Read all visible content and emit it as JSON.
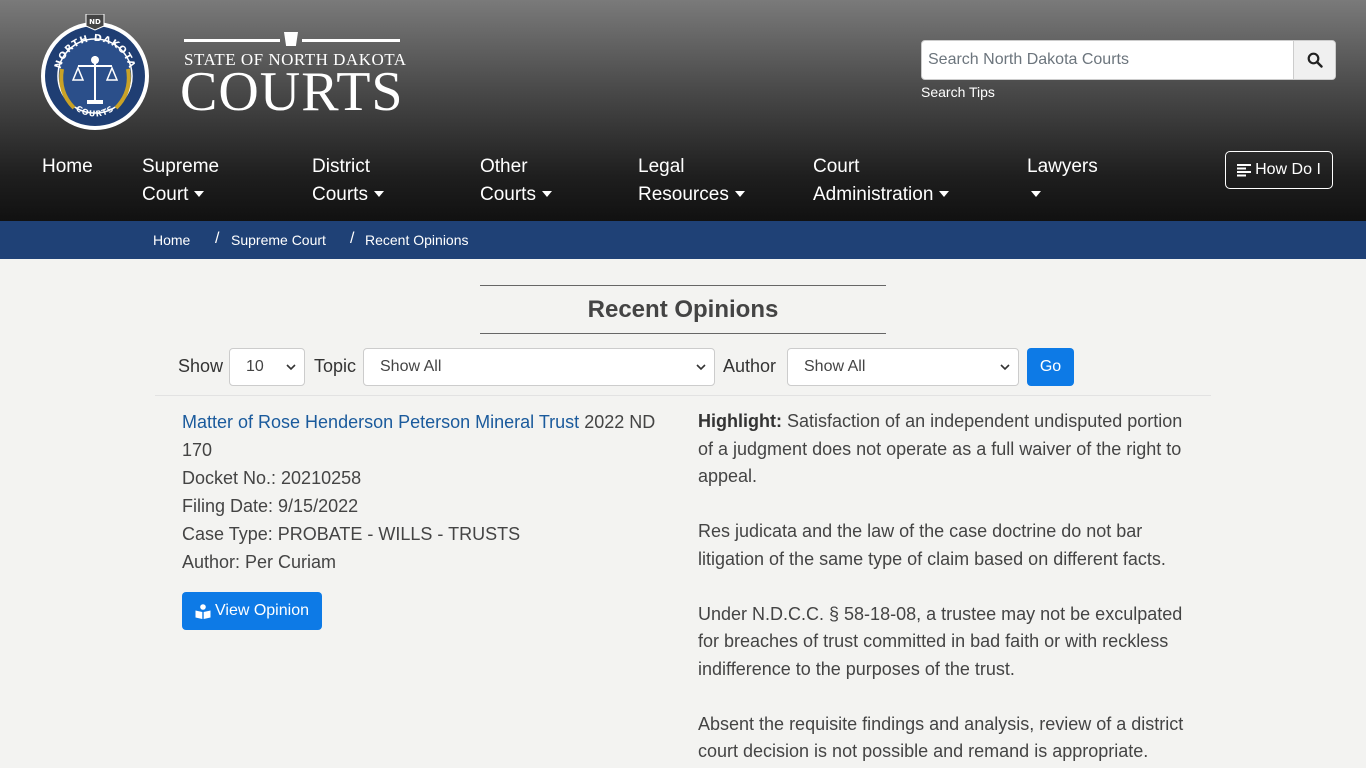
{
  "header": {
    "seal": {
      "top_text": "NORTH DAKOTA",
      "bottom_text": "COURTS",
      "badge": "ND"
    },
    "logo": {
      "small": "STATE OF NORTH DAKOTA",
      "big": "COURTS"
    },
    "search": {
      "placeholder": "Search North Dakota Courts",
      "tips": "Search Tips"
    }
  },
  "nav": {
    "items": [
      {
        "line1": "Home",
        "line2": ""
      },
      {
        "line1": "Supreme",
        "line2": "Court"
      },
      {
        "line1": "District",
        "line2": "Courts"
      },
      {
        "line1": "Other",
        "line2": "Courts"
      },
      {
        "line1": "Legal",
        "line2": "Resources"
      },
      {
        "line1": "Court",
        "line2": "Administration"
      },
      {
        "line1": "Lawyers",
        "line2": ""
      }
    ],
    "how_do_i": "How Do I"
  },
  "breadcrumb": [
    "Home",
    "Supreme Court",
    "Recent Opinions"
  ],
  "page": {
    "title": "Recent Opinions",
    "filters": {
      "show_label": "Show",
      "show_value": "10",
      "topic_label": "Topic",
      "topic_value": "Show All",
      "author_label": "Author",
      "author_value": "Show All",
      "go": "Go"
    },
    "opinion": {
      "title": "Matter of Rose Henderson Peterson Mineral Trust",
      "citation": "2022 ND 170",
      "docket": "Docket No.: 20210258",
      "filing_date": "Filing Date: 9/15/2022",
      "case_type": "Case Type: PROBATE - WILLS - TRUSTS",
      "author": "Author: Per Curiam",
      "view_button": "View Opinion",
      "highlight_label": "Highlight:",
      "highlights": [
        "Satisfaction of an independent undisputed portion of a judgment does not operate as a full waiver of the right to appeal.",
        "Res judicata and the law of the case doctrine do not bar litigation of the same type of claim based on different facts.",
        "Under N.D.C.C. § 58-18-08, a trustee may not be exculpated for breaches of trust committed in bad faith or with reckless indifference to the purposes of the trust.",
        "Absent the requisite findings and analysis, review of a district court decision is not possible and remand is appropriate."
      ]
    }
  },
  "colors": {
    "accent": "#0d7ae6",
    "breadcrumb_bg": "#1f4176",
    "link": "#1a5a9c",
    "seal_blue": "#1f3e73",
    "seal_gold": "#c9a227"
  },
  "icons": [
    "search-icon",
    "list-icon",
    "book-reader-icon",
    "chevron-down-icon",
    "caret-down-icon"
  ]
}
